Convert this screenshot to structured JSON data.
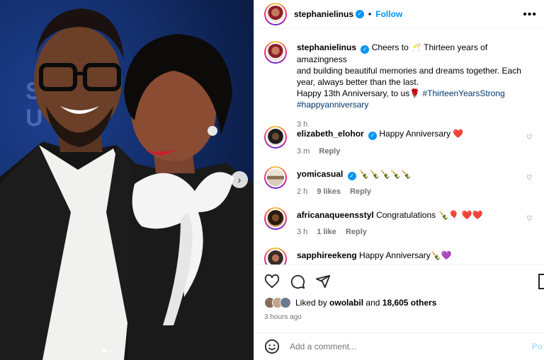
{
  "post": {
    "author": "stephanielinus",
    "follow_label": "Follow",
    "dot": "•",
    "more_label": "•••"
  },
  "caption": {
    "username": "stephanielinus",
    "text_line1": "Cheers to 🥂 Thirteen years of amazingness",
    "text_line2": "and building beautiful memories and dreams together. Each",
    "text_line3": "year, always better than the last.",
    "text_line4_prefix": "Happy 13th Anniversary, to us🌹",
    "hashtag1": "#ThirteenYearsStrong",
    "hashtag2": "#happyanniversary",
    "time": "3 h"
  },
  "comments": [
    {
      "username": "elizabeth_elohor",
      "verified": true,
      "text": "Happy Anniversary ❤️",
      "time": "3 m",
      "likes": "",
      "reply": "Reply"
    },
    {
      "username": "yomicasual",
      "verified": true,
      "text": "🍾🍾🍾🍾🍾",
      "time": "2 h",
      "likes": "9 likes",
      "reply": "Reply"
    },
    {
      "username": "africanaqueensstyl",
      "verified": false,
      "text": "Congratulations 🍾🎈 ❤️❤️",
      "time": "3 h",
      "likes": "1 like",
      "reply": "Reply"
    },
    {
      "username": "sapphireekeng",
      "verified": false,
      "text": "Happy Anniversary🍾💜",
      "time": "",
      "likes": "",
      "reply": ""
    }
  ],
  "likes": {
    "prefix": "Liked by",
    "user": "owolabil",
    "and": "and",
    "others": "18,605 others"
  },
  "time_ago": "3 hours ago",
  "comment_box": {
    "placeholder": "Add a comment...",
    "post_label": "Po"
  },
  "photo": {
    "wall_text_1": "S",
    "wall_text_2": "U",
    "slide_index": 1,
    "slide_count": 2
  },
  "colors": {
    "link_blue": "#0095f6",
    "hashtag": "#00376b",
    "muted": "#737373"
  }
}
